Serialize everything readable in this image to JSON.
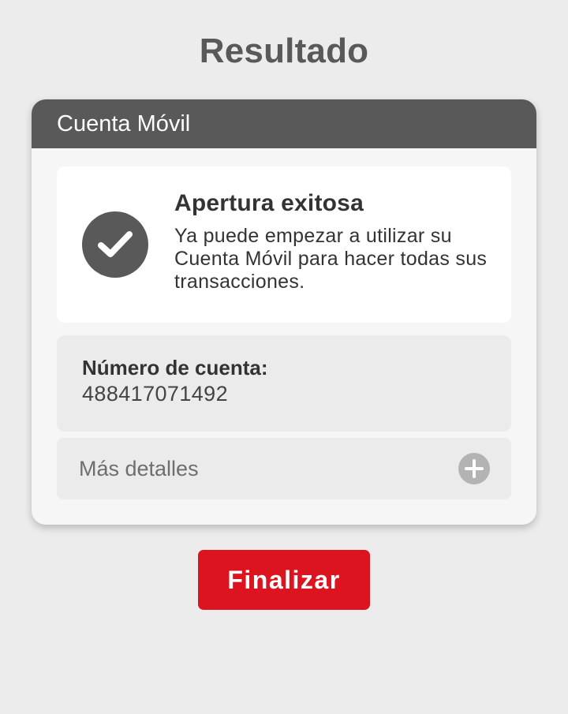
{
  "page": {
    "title": "Resultado"
  },
  "card": {
    "header": "Cuenta Móvil",
    "success": {
      "icon": "check-icon",
      "title": "Apertura exitosa",
      "message": "Ya puede empezar a utilizar su Cuenta Móvil para hacer todas sus transacciones."
    },
    "account": {
      "label": "Número de cuenta:",
      "number": "488417071492"
    },
    "details": {
      "label": "Más detalles",
      "icon": "plus-icon"
    }
  },
  "actions": {
    "finish_label": "Finalizar"
  },
  "colors": {
    "background": "#ececec",
    "header": "#595959",
    "accent": "#dc141f",
    "panel": "#ebebeb"
  }
}
